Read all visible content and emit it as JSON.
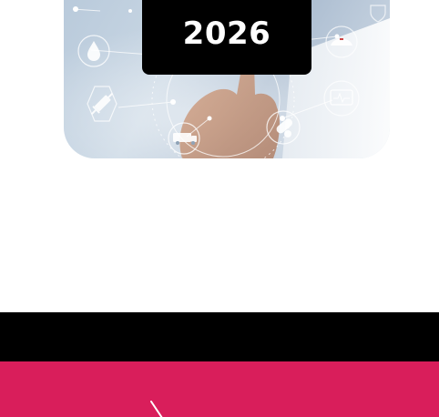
{
  "hero": {
    "year": "2026",
    "image_icons": [
      "drop-icon",
      "syringe-icon",
      "ambulance-icon",
      "pill-icon",
      "nurse-cap-icon",
      "monitor-icon",
      "hand-touch"
    ]
  },
  "colors": {
    "badge_bg": "#000000",
    "band_black": "#000000",
    "band_pink": "#d91e5b"
  }
}
